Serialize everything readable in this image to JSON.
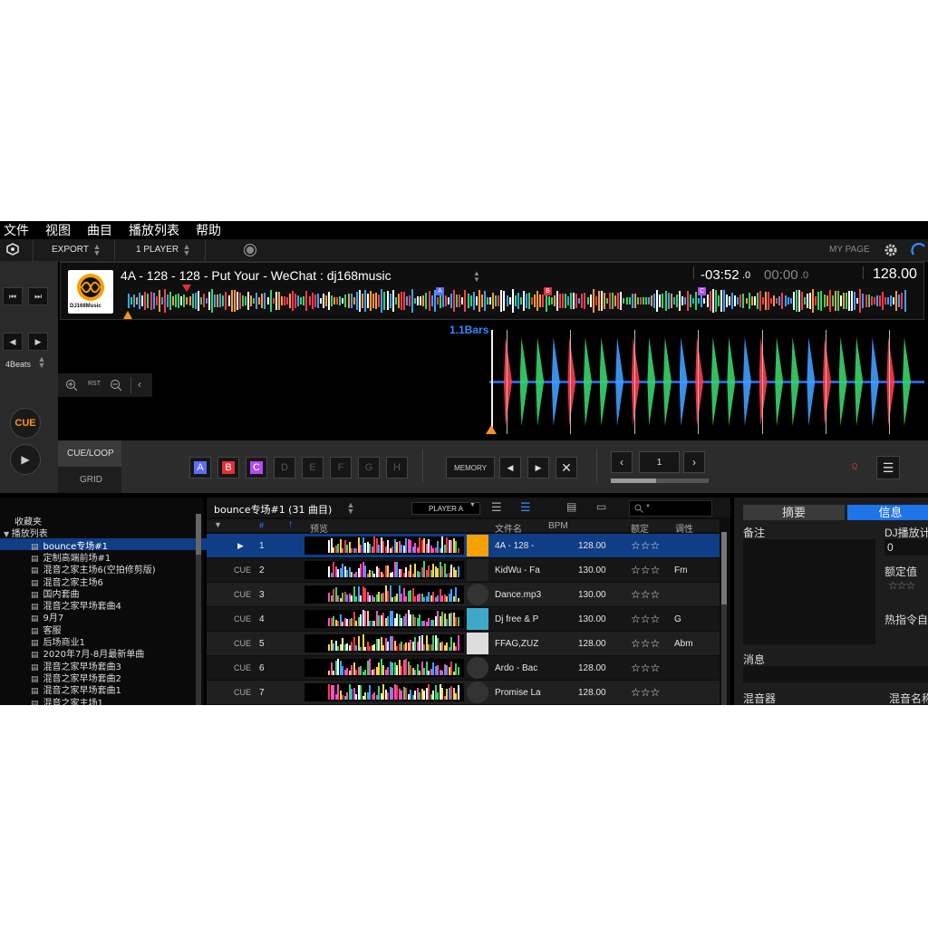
{
  "menu": [
    "文件",
    "视图",
    "曲目",
    "播放列表",
    "帮助"
  ],
  "toolbar": {
    "export": "EXPORT",
    "player_mode": "1 PLAYER",
    "my_page": "MY PAGE"
  },
  "deck": {
    "title": "4A - 128 - 128 - Put Your - WeChat : dj168music",
    "remaining": "-03:52",
    "remaining_dec": ".0",
    "elapsed": "00:00",
    "elapsed_dec": ".0",
    "bpm": "128.00",
    "logo_text": "DJ168Music",
    "beats": "4Beats",
    "rst": "RST",
    "cue": "CUE",
    "bars": "1.1Bars",
    "hot_cue_labels": {
      "a": "A",
      "b": "B",
      "c": "C"
    },
    "cue_markers": [
      "A",
      "B",
      "C"
    ],
    "cue_loop_tab": "CUE/LOOP",
    "grid_tab": "GRID",
    "hot_cues": [
      "A",
      "B",
      "C",
      "D",
      "E",
      "F",
      "G",
      "H"
    ],
    "memory": "MEMORY",
    "loop_value": "1",
    "q": "Q"
  },
  "tree": {
    "items": [
      "收藏夹",
      "播放列表",
      "bounce专场#1",
      "定制高端前场#1",
      "混音之家主场6(空拍修剪版)",
      "混音之家主场6",
      "国内套曲",
      "混音之家早场套曲4",
      "9月7",
      "客服",
      "后场商业1",
      "2020年7月-8月最新单曲",
      "混音之家早场套曲3",
      "混音之家早场套曲2",
      "混音之家早场套曲1",
      "混音之家主场1"
    ]
  },
  "list": {
    "title": "bounce专场#1 (31 曲目)",
    "player": "PLAYER A",
    "columns": {
      "num": "#",
      "preview": "预览",
      "filename": "文件名",
      "bpm": "BPM",
      "rating": "额定",
      "key": "调性"
    },
    "rows": [
      {
        "cue": "",
        "num": "1",
        "filename": "4A - 128 -",
        "bpm": "128.00",
        "rating": "☆☆☆",
        "key": ""
      },
      {
        "cue": "CUE",
        "num": "2",
        "filename": "KidWu - Fa",
        "bpm": "130.00",
        "rating": "☆☆☆",
        "key": "Fm"
      },
      {
        "cue": "CUE",
        "num": "3",
        "filename": "Dance.mp3",
        "bpm": "130.00",
        "rating": "☆☆☆",
        "key": ""
      },
      {
        "cue": "CUE",
        "num": "4",
        "filename": "Dj free & P",
        "bpm": "130.00",
        "rating": "☆☆☆",
        "key": "G"
      },
      {
        "cue": "CUE",
        "num": "5",
        "filename": "FFAG,ZUZ",
        "bpm": "128.00",
        "rating": "☆☆☆",
        "key": "Abm"
      },
      {
        "cue": "CUE",
        "num": "6",
        "filename": "Ardo - Bac",
        "bpm": "128.00",
        "rating": "☆☆☆",
        "key": ""
      },
      {
        "cue": "CUE",
        "num": "7",
        "filename": "Promise La",
        "bpm": "128.00",
        "rating": "☆☆☆",
        "key": ""
      }
    ]
  },
  "info": {
    "tab_summary": "摘要",
    "tab_info": "信息",
    "notes": "备注",
    "dj_play": "DJ播放计",
    "play_count": "0",
    "rating_label": "额定值",
    "rating": "☆☆☆",
    "hot_cue": "热指令自",
    "message": "消息",
    "mixer": "混音器",
    "mix_name": "混音名称"
  },
  "colors": {
    "accent_blue": "#1e74e8",
    "selected_row": "#0f3d86",
    "cue_orange": "#f7931e",
    "hotcue_a": "#5b6cff",
    "hotcue_b": "#e0303a",
    "hotcue_c": "#b24bf5"
  }
}
